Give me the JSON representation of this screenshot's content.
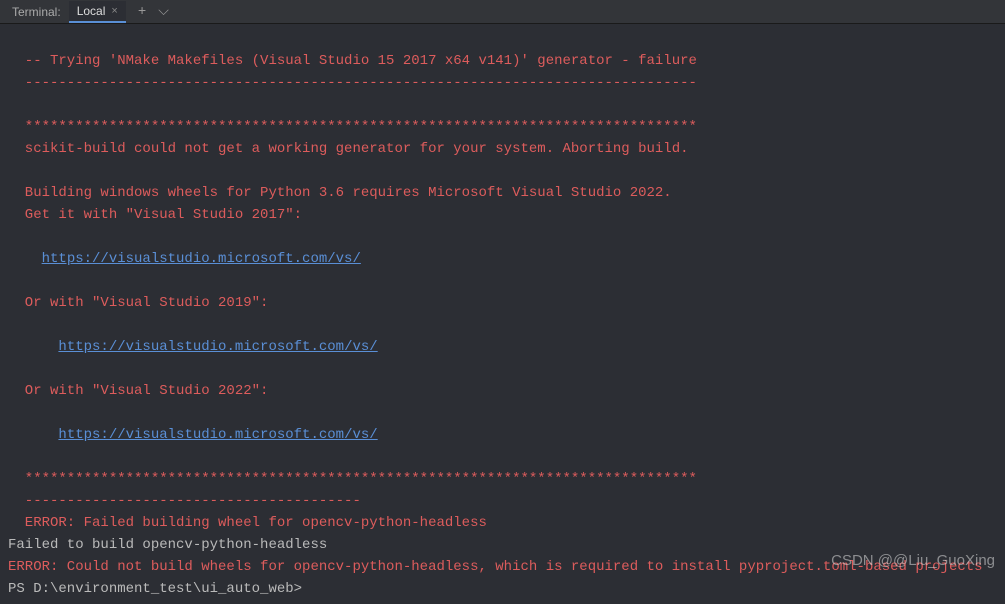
{
  "tabbar": {
    "title": "Terminal:",
    "active_tab": "Local",
    "close_glyph": "×",
    "add_glyph": "+",
    "dropdown_glyph": "⌵"
  },
  "lines": {
    "l1": "  --------------------------------------------------------------------------------",
    "l2": "  -- Trying 'NMake Makefiles (Visual Studio 15 2017 x64 v141)' generator - failure",
    "l3": "  --------------------------------------------------------------------------------",
    "l4": "",
    "l5": "  ********************************************************************************",
    "l6": "  scikit-build could not get a working generator for your system. Aborting build.",
    "l7": "",
    "l8": "  Building windows wheels for Python 3.6 requires Microsoft Visual Studio 2022.",
    "l9": "  Get it with \"Visual Studio 2017\":",
    "l10": "",
    "l11_pre": "    ",
    "l11_link": "https://visualstudio.microsoft.com/vs/",
    "l12": "",
    "l13": "  Or with \"Visual Studio 2019\":",
    "l14": "",
    "l15_pre": "      ",
    "l15_link": "https://visualstudio.microsoft.com/vs/",
    "l16": "",
    "l17": "  Or with \"Visual Studio 2022\":",
    "l18": "",
    "l19_pre": "      ",
    "l19_link": "https://visualstudio.microsoft.com/vs/",
    "l20": "",
    "l21": "  ********************************************************************************",
    "l22": "  ----------------------------------------",
    "l23": "  ERROR: Failed building wheel for opencv-python-headless",
    "l24": "Failed to build opencv-python-headless",
    "l25": "ERROR: Could not build wheels for opencv-python-headless, which is required to install pyproject.toml-based projects",
    "l26": "PS D:\\environment_test\\ui_auto_web>"
  },
  "watermark": "CSDN @@Liu_GuoXing"
}
